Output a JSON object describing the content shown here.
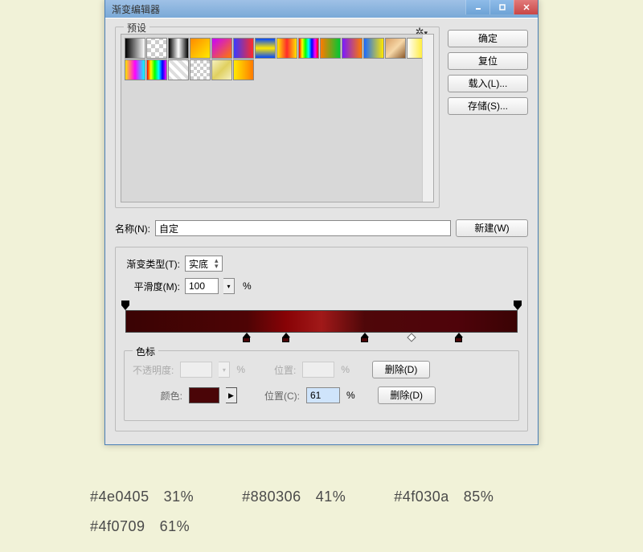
{
  "window": {
    "title": "渐变编辑器"
  },
  "buttons": {
    "ok": "确定",
    "reset": "复位",
    "load": "载入(L)...",
    "save": "存储(S)...",
    "new": "新建(W)"
  },
  "presets": {
    "label": "预设"
  },
  "name": {
    "label": "名称(N):",
    "value": "自定"
  },
  "gradient_type": {
    "label": "渐变类型(T):",
    "value": "实底"
  },
  "smoothness": {
    "label": "平滑度(M):",
    "value": "100",
    "suffix": "%"
  },
  "stops_group": {
    "label": "色标"
  },
  "opacity_row": {
    "label": "不透明度:",
    "value": "",
    "pct": "%",
    "pos_label": "位置:",
    "pos_value": "",
    "delete": "删除(D)"
  },
  "color_row": {
    "label": "颜色:",
    "pos_label": "位置(C):",
    "pos_value": "61",
    "pct": "%",
    "delete": "删除(D)"
  },
  "preset_swatches": [
    "linear-gradient(to right,#000,#fff)",
    "repeating-conic-gradient(#ccc 0 25%,#fff 0 50%) 0/10px 10px",
    "linear-gradient(to right,#000,#fff 50%,#000)",
    "linear-gradient(to bottom right,#ff8a00,#ffea00)",
    "linear-gradient(to bottom right,#c800ff,#ff7a00)",
    "linear-gradient(to right,#3a3aff,#ff2a2a)",
    "linear-gradient(to bottom,#0047ff,#ffe600,#0047ff)",
    "linear-gradient(to right,#ffe600,#ff2a2a,#ffe600)",
    "linear-gradient(to right,#ff0000,#ffff00,#00ff00,#00ffff,#0000ff,#ff00ff,#ff0000)",
    "linear-gradient(to right,#ff7a00,#00c832)",
    "linear-gradient(to right,#7a1aff,#ff7a00)",
    "linear-gradient(to right,#1a6aff,#ffe600)",
    "linear-gradient(135deg,#d9a066,#f6d7a7,#8c5a2b)",
    "linear-gradient(to right,#fff,#ffe600)",
    "linear-gradient(to right,#ffe600,#ff00ff,#00ffff)",
    "linear-gradient(to right,#ff0000,#ffff00,#00ff00,#00ffff,#0000ff,#ff00ff)",
    "repeating-linear-gradient(45deg,#ddd 0 4px,#fff 4px 8px)",
    "repeating-conic-gradient(#ccc 0 25%,#fff 0 50%) 0/8px 8px",
    "linear-gradient(135deg,#f5f0c0,#e0d060,#f5f0c0)",
    "linear-gradient(to right,#ffea00,#ff7a00)"
  ],
  "gradient_stops": {
    "opacity": [
      0,
      100
    ],
    "color": [
      31,
      41,
      61,
      85
    ],
    "midpoint": 73
  },
  "annotations": [
    {
      "hex": "#4e0405",
      "pct": "31%"
    },
    {
      "hex": "#880306",
      "pct": "41%"
    },
    {
      "hex": "#4f030a",
      "pct": "85%"
    },
    {
      "hex": "#4f0709",
      "pct": "61%"
    }
  ]
}
